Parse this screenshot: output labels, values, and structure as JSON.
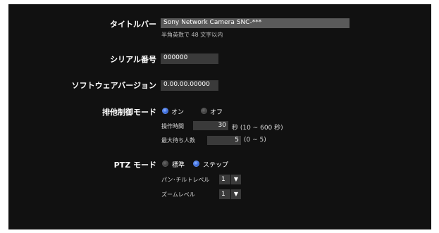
{
  "title_bar": {
    "label": "タイトルバー",
    "value": "Sony Network Camera SNC-***",
    "note": "半角英数で 48 文字以内"
  },
  "serial": {
    "label": "シリアル番号",
    "value": "000000"
  },
  "software_version": {
    "label": "ソフトウェアバージョン",
    "value": "0.00.00.00000"
  },
  "exclusive_control": {
    "label": "排他制御モード",
    "option_on": "オン",
    "option_off": "オフ",
    "selected": "オン",
    "operation_time_label": "操作時間",
    "operation_time_value": "30",
    "operation_time_unit": "秒 (10 ~ 600 秒)",
    "max_wait_label": "最大待ち人数",
    "max_wait_value": "5",
    "max_wait_range": "(0 ~ 5)"
  },
  "ptz_mode": {
    "label": "PTZ モード",
    "option_standard": "標準",
    "option_step": "ステップ",
    "selected": "ステップ",
    "pan_tilt_label": "パン･チルトレベル",
    "pan_tilt_value": "1",
    "zoom_label": "ズームレベル",
    "zoom_value": "1"
  },
  "colors": {
    "panel_bg": "#111111",
    "field_bg": "#3a3a3a",
    "radio_selected": "#3d6fe0"
  },
  "icons": {
    "dropdown": "▼"
  }
}
